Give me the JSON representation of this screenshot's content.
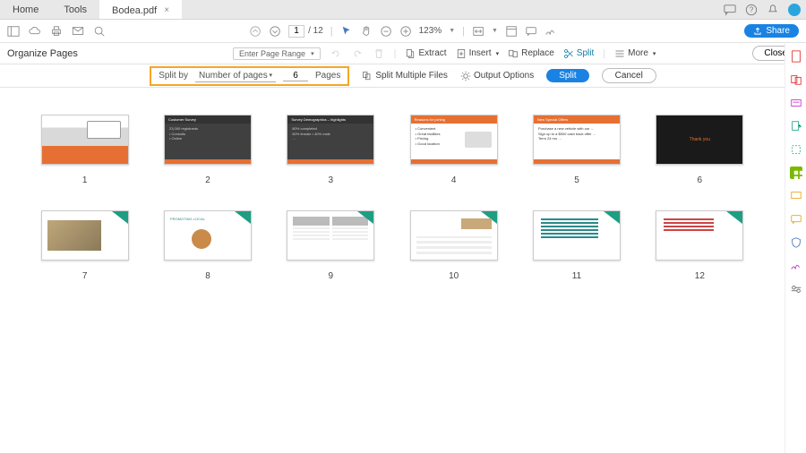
{
  "tabs": {
    "home": "Home",
    "tools": "Tools",
    "file": "Bodea.pdf"
  },
  "toolbar": {
    "page_current": "1",
    "page_total": "/ 12",
    "zoom": "123%",
    "share": "Share"
  },
  "organize": {
    "title": "Organize Pages",
    "page_range": "Enter Page Range",
    "extract": "Extract",
    "insert": "Insert",
    "replace": "Replace",
    "split": "Split",
    "more": "More",
    "close": "Close"
  },
  "splitbar": {
    "split_by": "Split by",
    "method": "Number of pages",
    "count": "6",
    "pages": "Pages",
    "split_multiple": "Split Multiple Files",
    "output_options": "Output Options",
    "split_btn": "Split",
    "cancel": "Cancel"
  },
  "thumbs": [
    "1",
    "2",
    "3",
    "4",
    "5",
    "6",
    "7",
    "8",
    "9",
    "10",
    "11",
    "12"
  ],
  "slide_text": {
    "s2_title": "Customer Survey",
    "s3_title": "Survey Demographics – highlights",
    "s4_title": "Reasons for joining",
    "s5_title": "New Special Offers",
    "s6": "Thank you"
  }
}
